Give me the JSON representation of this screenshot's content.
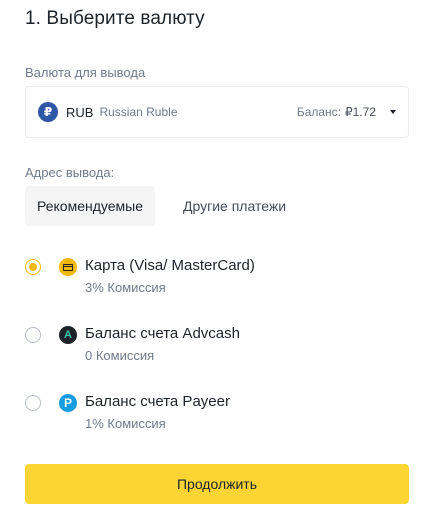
{
  "step": {
    "title": "1. Выберите валюту"
  },
  "currency": {
    "label": "Валюта для вывода",
    "icon_glyph": "₽",
    "code": "RUB",
    "name": "Russian Ruble",
    "balance_label": "Баланс:",
    "balance_value": "₽1.72",
    "icon": "chevron-down-icon"
  },
  "address": {
    "label": "Адрес вывода:",
    "tabs": [
      {
        "label": "Рекомендуемые",
        "active": true
      },
      {
        "label": "Другие платежи",
        "active": false
      }
    ]
  },
  "methods": [
    {
      "title": "Карта (Visa/ MasterCard)",
      "fee": "3% Комиссия",
      "selected": true,
      "icon": "card-icon",
      "icon_color": "#f0b90b"
    },
    {
      "title": "Баланс счета Advcash",
      "fee": "0 Комиссия",
      "selected": false,
      "icon": "advcash-icon",
      "icon_glyph": "A",
      "icon_color": "#1e2329"
    },
    {
      "title": "Баланс счета Payeer",
      "fee": "1% Комиссия",
      "selected": false,
      "icon": "payeer-icon",
      "icon_glyph": "P",
      "icon_color": "#1a9de0"
    }
  ],
  "actions": {
    "continue_label": "Продолжить"
  },
  "colors": {
    "accent": "#f0b90b",
    "button": "#fcd535",
    "text": "#1e2329",
    "muted": "#707a8a"
  }
}
